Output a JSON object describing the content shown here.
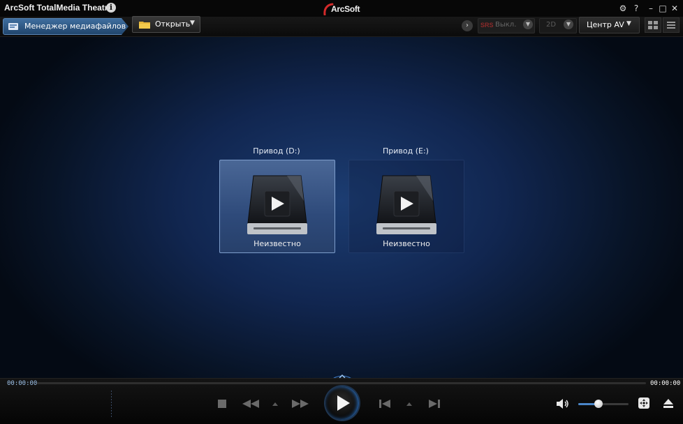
{
  "window": {
    "title": "ArcSoft TotalMedia Theatre",
    "brand": "ArcSoft",
    "info_icon_glyph": "i",
    "controls": {
      "settings": "⚙",
      "help": "?",
      "minimize": "–",
      "maximize": "□",
      "close": "✕"
    }
  },
  "toolbar": {
    "breadcrumb": "Менеджер медиафайлов",
    "open_label": "Открыть",
    "srs_logo": "SRS",
    "srs_label": "Выкл.",
    "mode_label": "2D",
    "av_center_label": "Центр AV"
  },
  "drives": [
    {
      "label": "Привод (D:)",
      "status": "Неизвестно",
      "selected": true
    },
    {
      "label": "Привод (E:)",
      "status": "Неизвестно",
      "selected": false
    }
  ],
  "playback": {
    "elapsed": "00:00:00",
    "total": "00:00:00",
    "progress": 0.0,
    "volume": 0.4
  },
  "colors": {
    "accent": "#4a86c8",
    "breadcrumb": "#2f5a88",
    "background": "#112650"
  }
}
